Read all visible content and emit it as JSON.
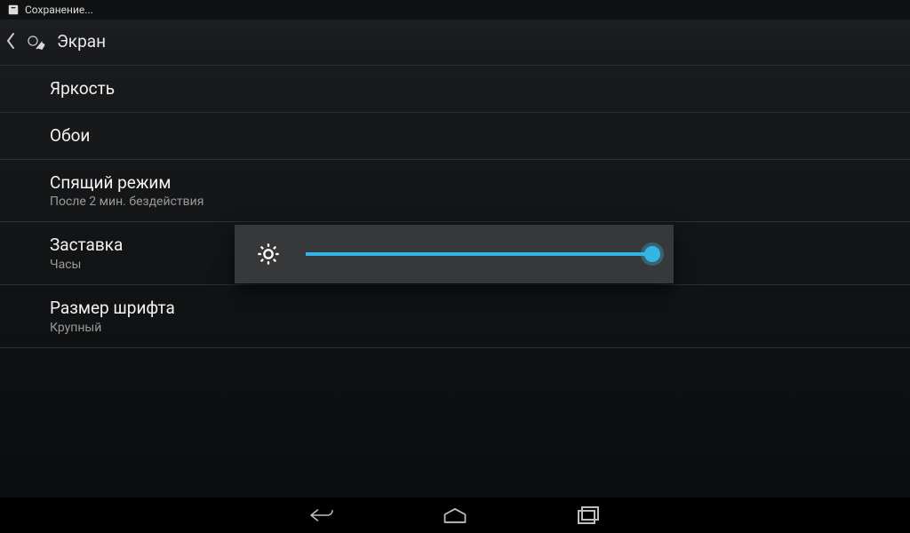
{
  "statusbar": {
    "label": "Сохранение..."
  },
  "actionbar": {
    "title": "Экран"
  },
  "settings": {
    "brightness": {
      "title": "Яркость"
    },
    "wallpaper": {
      "title": "Обои"
    },
    "sleep": {
      "title": "Спящий режим",
      "summary": "После 2 мин. бездействия"
    },
    "daydream": {
      "title": "Заставка",
      "summary": "Часы"
    },
    "fontsize": {
      "title": "Размер шрифта",
      "summary": "Крупный"
    }
  },
  "brightness_slider": {
    "value_percent": 100
  },
  "colors": {
    "accent": "#33b5e5"
  }
}
